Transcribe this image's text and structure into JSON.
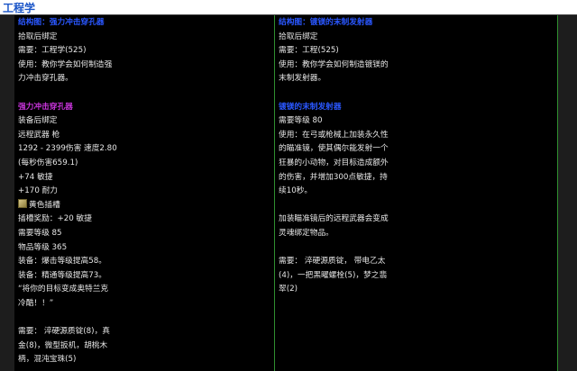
{
  "page_title": "工程学",
  "left": {
    "pattern_title": "结构图：强力冲击穿孔器",
    "pattern_lines": [
      "拾取后绑定",
      "需要：工程学(525)",
      "使用：教你学会如何制造强",
      "力冲击穿孔器。"
    ],
    "item_title": "强力冲击穿孔器",
    "item_lines_1": [
      "装备后绑定",
      "远程武器 枪",
      "1292 - 2399伤害 速度2.80",
      "(每秒伤害659.1)",
      "+74 敏捷",
      "+170 耐力"
    ],
    "socket": {
      "icon": "yellow-socket-icon",
      "label": "黄色插槽"
    },
    "item_lines_2": [
      "插槽奖励：+20 敏捷",
      "需要等级 85",
      "物品等级 365",
      "装备：爆击等级提高58。",
      "装备：精通等级提高73。",
      "“将你的目标变成奥特兰克",
      "冷酷！！”"
    ],
    "reagent_lines": [
      "需要： 淬硬源质锭(8)，真",
      "金(8)，微型扳机，胡桃木",
      "柄，混沌宝珠(5)"
    ]
  },
  "right": {
    "pattern_title": "结构图：镀镁的末制发射器",
    "pattern_lines": [
      "拾取后绑定",
      "需要：工程(525)",
      "使用：教你学会如何制造镀镁的",
      "末制发射器。"
    ],
    "item_title": "镀镁的末制发射器",
    "item_lines_1": [
      "需要等级 80",
      "使用：在弓或枪械上加装永久性",
      "的瞄准镜，使其偶尔能发射一个",
      "狂暴的小动物，对目标造成额外",
      "的伤害，并增加300点敏捷，持",
      "续10秒。"
    ],
    "item_lines_2": [
      "加装瞄准镜后的远程武器会变成",
      "灵魂绑定物品。"
    ],
    "reagent_lines": [
      "需要： 淬硬源质锭， 带电乙太",
      "(4)，一把黑曜螺栓(5)，梦之翡",
      "翠(2)"
    ]
  }
}
